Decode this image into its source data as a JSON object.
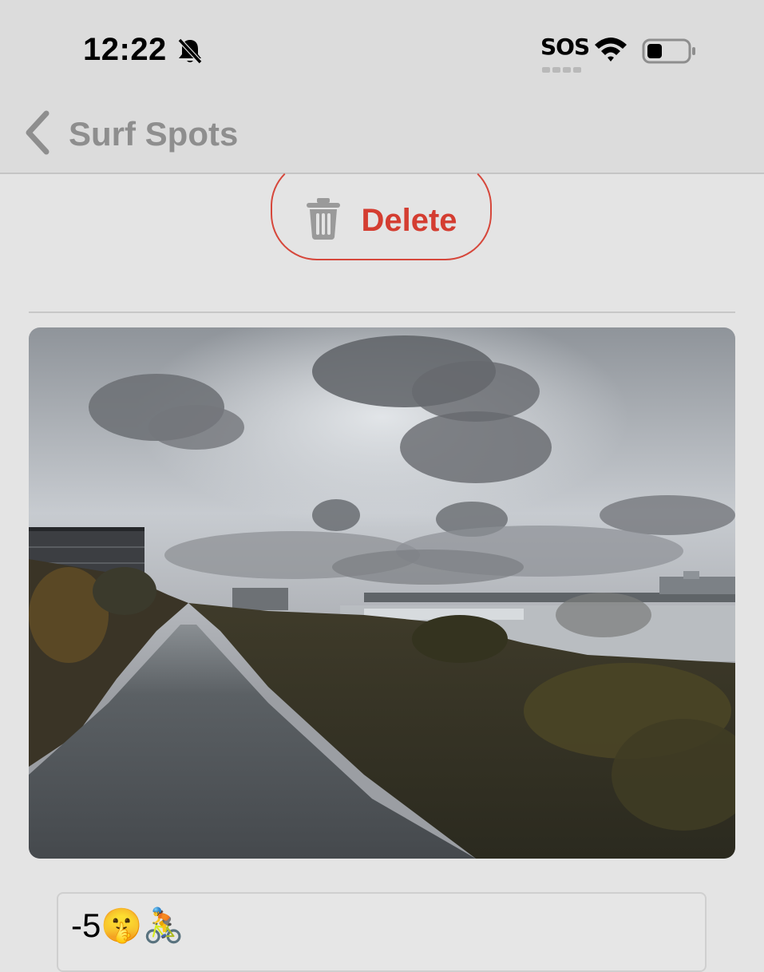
{
  "status_bar": {
    "time": "12:22",
    "sos": "SOS",
    "icons": [
      "bell-slash-icon",
      "wifi-icon",
      "battery-icon"
    ]
  },
  "nav": {
    "back_label": "Surf Spots",
    "back_icon": "chevron-left-icon"
  },
  "actions": {
    "delete_label": "Delete",
    "delete_icon": "trash-icon"
  },
  "photo": {
    "kind": "landscape-photo"
  },
  "note_field": {
    "value": "-5🤫🚴"
  },
  "colors": {
    "accent_red": "#d43d31",
    "nav_gray": "#8e8e8e",
    "background": "#e4e4e4"
  }
}
